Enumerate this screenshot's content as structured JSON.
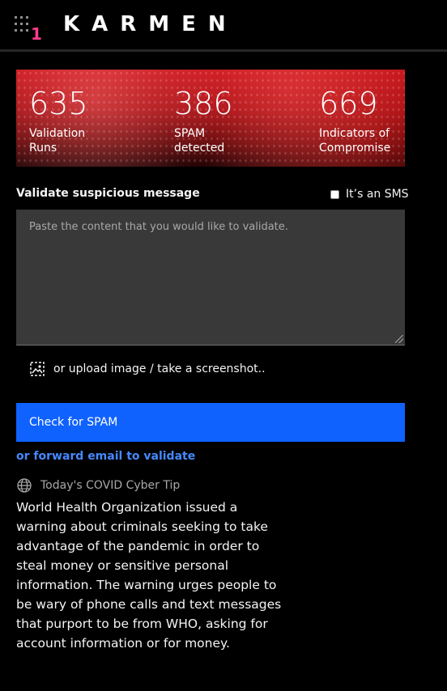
{
  "header": {
    "brand": "KARMEN",
    "notification_count": "1"
  },
  "stats": [
    {
      "value": "635",
      "label": "Validation Runs"
    },
    {
      "value": "386",
      "label": "SPAM detected"
    },
    {
      "value": "669",
      "label": "Indicators of Compromise"
    }
  ],
  "form": {
    "label": "Validate suspicious message",
    "sms_label": "It’s an SMS",
    "sms_checked": false,
    "textarea_placeholder": "Paste the content that you would like to validate.",
    "textarea_value": "",
    "upload_label": "or upload image / take a screenshot..",
    "submit_label": "Check for SPAM",
    "forward_link": "or forward email to validate"
  },
  "tip": {
    "title": "Today's COVID Cyber Tip",
    "body": "World Health Organization issued a warning about criminals seeking to take advantage of the pandemic in order to steal money or sensitive personal information. The warning urges people to be wary of phone calls and text messages that purport to be from WHO, asking for account information or for money."
  },
  "icons": {
    "apps": "app-grid-icon",
    "upload": "image-upload-icon",
    "globe": "globe-icon"
  },
  "colors": {
    "accent": "#0f62fe",
    "link": "#4589ff",
    "badge": "#ff3c8c",
    "stats_bg": "#c8141b"
  }
}
